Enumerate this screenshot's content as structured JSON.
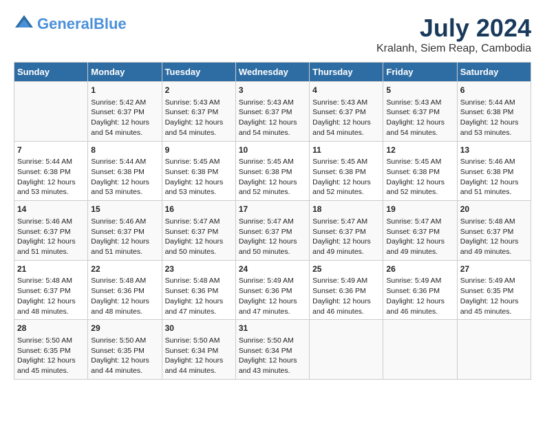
{
  "header": {
    "logo_line1": "General",
    "logo_line2": "Blue",
    "title": "July 2024",
    "subtitle": "Kralanh, Siem Reap, Cambodia"
  },
  "days_of_week": [
    "Sunday",
    "Monday",
    "Tuesday",
    "Wednesday",
    "Thursday",
    "Friday",
    "Saturday"
  ],
  "weeks": [
    [
      {
        "day": "",
        "content": ""
      },
      {
        "day": "1",
        "content": "Sunrise: 5:42 AM\nSunset: 6:37 PM\nDaylight: 12 hours\nand 54 minutes."
      },
      {
        "day": "2",
        "content": "Sunrise: 5:43 AM\nSunset: 6:37 PM\nDaylight: 12 hours\nand 54 minutes."
      },
      {
        "day": "3",
        "content": "Sunrise: 5:43 AM\nSunset: 6:37 PM\nDaylight: 12 hours\nand 54 minutes."
      },
      {
        "day": "4",
        "content": "Sunrise: 5:43 AM\nSunset: 6:37 PM\nDaylight: 12 hours\nand 54 minutes."
      },
      {
        "day": "5",
        "content": "Sunrise: 5:43 AM\nSunset: 6:37 PM\nDaylight: 12 hours\nand 54 minutes."
      },
      {
        "day": "6",
        "content": "Sunrise: 5:44 AM\nSunset: 6:38 PM\nDaylight: 12 hours\nand 53 minutes."
      }
    ],
    [
      {
        "day": "7",
        "content": "Sunrise: 5:44 AM\nSunset: 6:38 PM\nDaylight: 12 hours\nand 53 minutes."
      },
      {
        "day": "8",
        "content": "Sunrise: 5:44 AM\nSunset: 6:38 PM\nDaylight: 12 hours\nand 53 minutes."
      },
      {
        "day": "9",
        "content": "Sunrise: 5:45 AM\nSunset: 6:38 PM\nDaylight: 12 hours\nand 53 minutes."
      },
      {
        "day": "10",
        "content": "Sunrise: 5:45 AM\nSunset: 6:38 PM\nDaylight: 12 hours\nand 52 minutes."
      },
      {
        "day": "11",
        "content": "Sunrise: 5:45 AM\nSunset: 6:38 PM\nDaylight: 12 hours\nand 52 minutes."
      },
      {
        "day": "12",
        "content": "Sunrise: 5:45 AM\nSunset: 6:38 PM\nDaylight: 12 hours\nand 52 minutes."
      },
      {
        "day": "13",
        "content": "Sunrise: 5:46 AM\nSunset: 6:38 PM\nDaylight: 12 hours\nand 51 minutes."
      }
    ],
    [
      {
        "day": "14",
        "content": "Sunrise: 5:46 AM\nSunset: 6:37 PM\nDaylight: 12 hours\nand 51 minutes."
      },
      {
        "day": "15",
        "content": "Sunrise: 5:46 AM\nSunset: 6:37 PM\nDaylight: 12 hours\nand 51 minutes."
      },
      {
        "day": "16",
        "content": "Sunrise: 5:47 AM\nSunset: 6:37 PM\nDaylight: 12 hours\nand 50 minutes."
      },
      {
        "day": "17",
        "content": "Sunrise: 5:47 AM\nSunset: 6:37 PM\nDaylight: 12 hours\nand 50 minutes."
      },
      {
        "day": "18",
        "content": "Sunrise: 5:47 AM\nSunset: 6:37 PM\nDaylight: 12 hours\nand 49 minutes."
      },
      {
        "day": "19",
        "content": "Sunrise: 5:47 AM\nSunset: 6:37 PM\nDaylight: 12 hours\nand 49 minutes."
      },
      {
        "day": "20",
        "content": "Sunrise: 5:48 AM\nSunset: 6:37 PM\nDaylight: 12 hours\nand 49 minutes."
      }
    ],
    [
      {
        "day": "21",
        "content": "Sunrise: 5:48 AM\nSunset: 6:37 PM\nDaylight: 12 hours\nand 48 minutes."
      },
      {
        "day": "22",
        "content": "Sunrise: 5:48 AM\nSunset: 6:36 PM\nDaylight: 12 hours\nand 48 minutes."
      },
      {
        "day": "23",
        "content": "Sunrise: 5:48 AM\nSunset: 6:36 PM\nDaylight: 12 hours\nand 47 minutes."
      },
      {
        "day": "24",
        "content": "Sunrise: 5:49 AM\nSunset: 6:36 PM\nDaylight: 12 hours\nand 47 minutes."
      },
      {
        "day": "25",
        "content": "Sunrise: 5:49 AM\nSunset: 6:36 PM\nDaylight: 12 hours\nand 46 minutes."
      },
      {
        "day": "26",
        "content": "Sunrise: 5:49 AM\nSunset: 6:36 PM\nDaylight: 12 hours\nand 46 minutes."
      },
      {
        "day": "27",
        "content": "Sunrise: 5:49 AM\nSunset: 6:35 PM\nDaylight: 12 hours\nand 45 minutes."
      }
    ],
    [
      {
        "day": "28",
        "content": "Sunrise: 5:50 AM\nSunset: 6:35 PM\nDaylight: 12 hours\nand 45 minutes."
      },
      {
        "day": "29",
        "content": "Sunrise: 5:50 AM\nSunset: 6:35 PM\nDaylight: 12 hours\nand 44 minutes."
      },
      {
        "day": "30",
        "content": "Sunrise: 5:50 AM\nSunset: 6:34 PM\nDaylight: 12 hours\nand 44 minutes."
      },
      {
        "day": "31",
        "content": "Sunrise: 5:50 AM\nSunset: 6:34 PM\nDaylight: 12 hours\nand 43 minutes."
      },
      {
        "day": "",
        "content": ""
      },
      {
        "day": "",
        "content": ""
      },
      {
        "day": "",
        "content": ""
      }
    ]
  ]
}
